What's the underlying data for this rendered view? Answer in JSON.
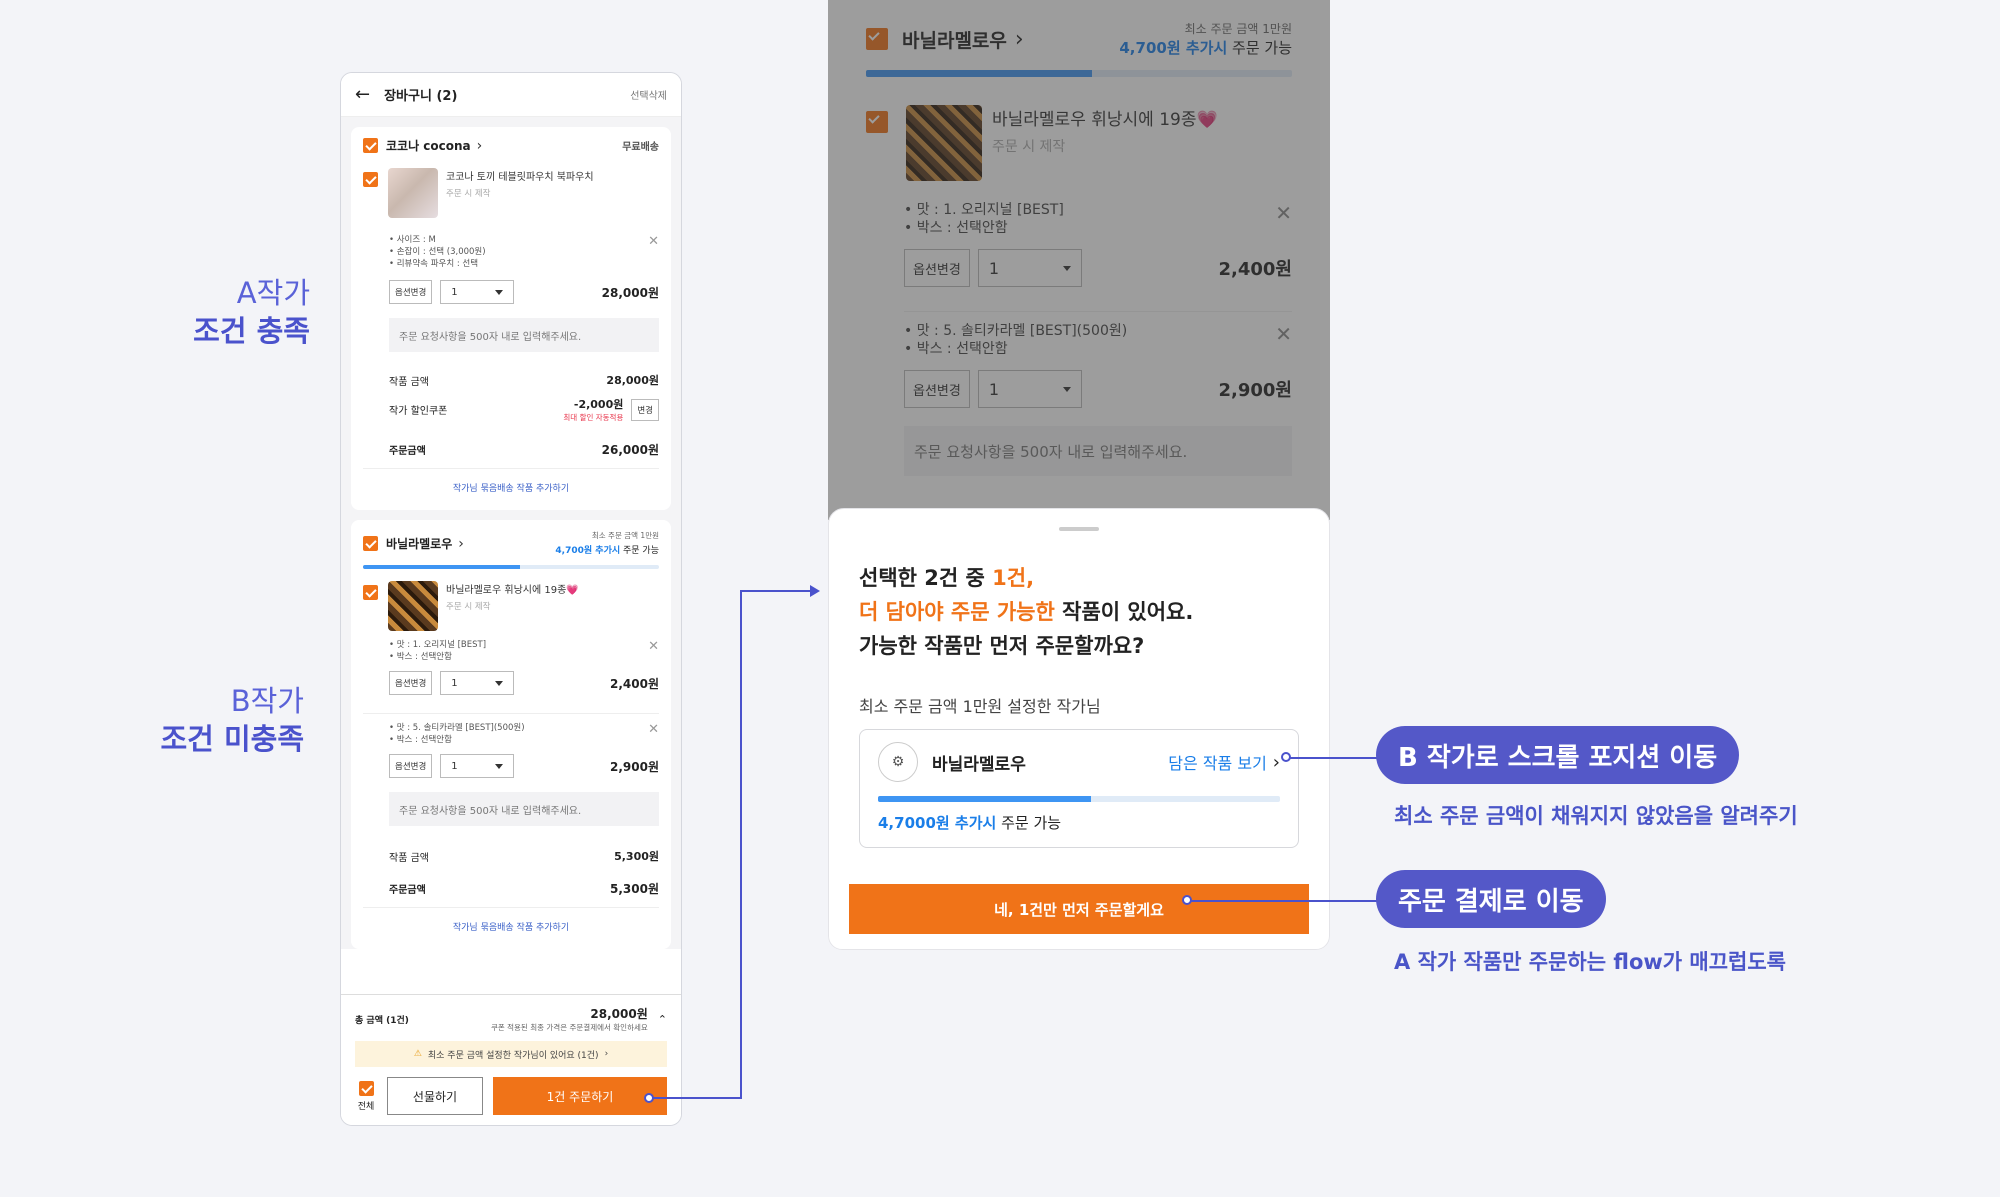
{
  "annotations": {
    "a_line1": "A작가",
    "a_line2": "조건 충족",
    "b_line1": "B작가",
    "b_line2": "조건 미충족"
  },
  "cart": {
    "title": "장바구니 (2)",
    "delete_selected": "선택삭제",
    "shop_a": {
      "name": "코코나 cocona",
      "badge": "무료배송",
      "item_name": "코코나 토끼 테블릿파우치 북파우치",
      "item_sub": "주문 시 제작",
      "options": [
        "• 사이즈 : M",
        "• 손잡이 : 선택 (3,000원)",
        "• 리뷰약속 파우치 : 선택"
      ],
      "option_button": "옵션변경",
      "qty": "1",
      "price": "28,000원",
      "memo_placeholder": "주문 요청사항을 500자 내로 입력해주세요.",
      "item_amount_label": "작품 금액",
      "item_amount": "28,000원",
      "coupon_label": "작가 할인쿠폰",
      "coupon_value": "-2,000원",
      "coupon_note": "최대 할인 자동적용",
      "coupon_change": "변경",
      "order_amount_label": "주문금액",
      "order_amount": "26,000원",
      "bundle_link": "작가님 묶음배송 작품 추가하기"
    },
    "shop_b": {
      "name": "바닐라멜로우",
      "min_note": "최소 주문 금액 1만원",
      "add_amount": "4,700원 추가시",
      "available": "주문 가능",
      "progress": 0.53,
      "item_name": "바닐라멜로우 휘낭시에 19종💗",
      "item_sub": "주문 시 제작",
      "opt1": [
        "• 맛 : 1. 오리지널 [BEST]",
        "• 박스 : 선택안함"
      ],
      "opt1_price": "2,400원",
      "opt2": [
        "• 맛 : 5. 솔티카라멜 [BEST](500원)",
        "• 박스 : 선택안함"
      ],
      "opt2_price": "2,900원",
      "option_button": "옵션변경",
      "qty": "1",
      "memo_placeholder": "주문 요청사항을 500자 내로 입력해주세요.",
      "item_amount_label": "작품 금액",
      "item_amount": "5,300원",
      "order_amount_label": "주문금액",
      "order_amount": "5,300원",
      "bundle_link": "작가님 묶음배송 작품 추가하기"
    },
    "footer": {
      "total_label": "총 금액 (1건)",
      "total": "28,000원",
      "total_note": "쿠폰 적용된 최종 가격은 주문결제에서 확인하세요",
      "warning": "최소 주문 금액 설정한 작가님이 있어요 (1건)",
      "all_label": "전체",
      "gift_button": "선물하기",
      "order_button": "1건 주문하기"
    }
  },
  "modal": {
    "shop_name": "바닐라멜로우",
    "min_note": "최소 주문 금액 1만원",
    "add_amount": "4,700원 추가시",
    "available": "주문 가능",
    "item_name": "바닐라멜로우 휘낭시에 19종💗",
    "item_sub": "주문 시 제작",
    "opt1": [
      "• 맛 : 1. 오리지널 [BEST]",
      "• 박스 : 선택안함"
    ],
    "opt1_price": "2,400원",
    "opt2": [
      "• 맛 : 5. 솔티카라멜 [BEST](500원)",
      "• 박스 : 선택안함"
    ],
    "opt2_price": "2,900원",
    "option_button": "옵션변경",
    "qty": "1",
    "memo_placeholder": "주문 요청사항을 500자 내로 입력해주세요.",
    "q1_a": "선택한 2건 중 ",
    "q1_b": "1건,",
    "q2_a": "더 담아야 주문 가능한",
    "q2_b": " 작품이 있어요.",
    "q3": "가능한 작품만 먼저 주문할까요?",
    "min_section": "최소 주문 금액 1만원 설정한 작가님",
    "box_shop": "바닐라멜로우",
    "view_items": "담은 작품 보기",
    "box_add": "4,7000원 추가시",
    "box_available": "주문 가능",
    "box_progress": 0.53,
    "cta": "네, 1건만 먼저 주문할게요"
  },
  "callouts": {
    "scroll_pill": "B 작가로 스크롤 포지션 이동",
    "scroll_sub": "최소 주문 금액이 채워지지 않았음을 알려주기",
    "order_pill": "주문 결제로 이동",
    "order_sub": "A 작가 작품만 주문하는 flow가 매끄럽도록"
  },
  "colors": {
    "accent": "#f07318",
    "blue": "#1a7ee8",
    "annotation": "#4a52cc"
  }
}
